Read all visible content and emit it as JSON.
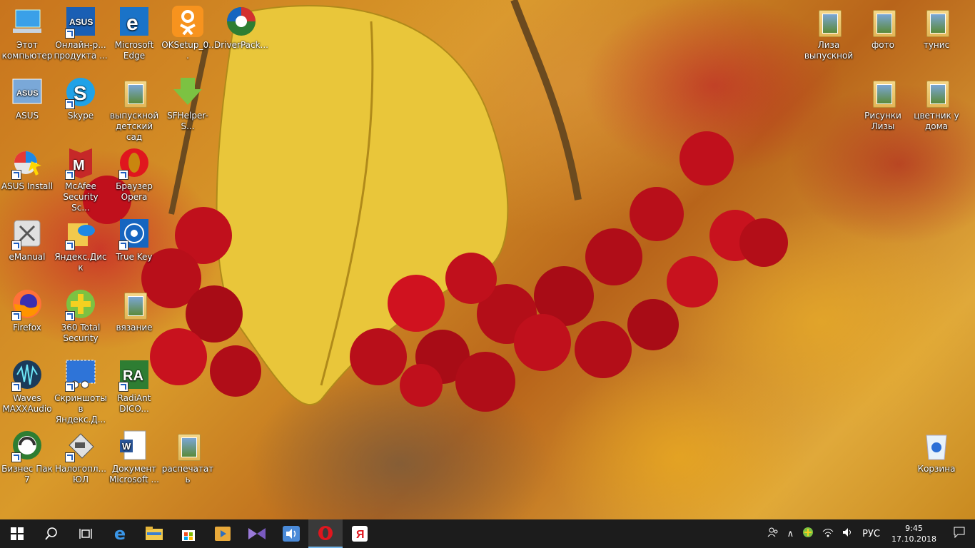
{
  "desktop": {
    "icons_left": [
      {
        "label": "Этот компьютер",
        "icon": "this-pc-icon",
        "shortcut": false
      },
      {
        "label": "Онлайн-р... продукта ...",
        "icon": "asus-online-icon",
        "shortcut": true
      },
      {
        "label": "Microsoft Edge",
        "icon": "edge-icon",
        "shortcut": false
      },
      {
        "label": "OKSetup_0...",
        "icon": "odnoklassniki-icon",
        "shortcut": false
      },
      {
        "label": "DriverPack...",
        "icon": "driverpack-icon",
        "shortcut": false
      },
      {
        "label": "ASUS",
        "icon": "asus-icon",
        "shortcut": false
      },
      {
        "label": "Skype",
        "icon": "skype-icon",
        "shortcut": true
      },
      {
        "label": "выпускной детский сад",
        "icon": "folder-icon",
        "shortcut": false
      },
      {
        "label": "SFHelper-S...",
        "icon": "download-arrow-icon",
        "shortcut": false
      },
      {
        "label": "ASUS Install",
        "icon": "asus-install-icon",
        "shortcut": true
      },
      {
        "label": "McAfee Security Sc...",
        "icon": "mcafee-icon",
        "shortcut": true
      },
      {
        "label": "Браузер Opera",
        "icon": "opera-icon",
        "shortcut": true
      },
      {
        "label": "eManual",
        "icon": "emanual-icon",
        "shortcut": true
      },
      {
        "label": "Яндекс.Диск",
        "icon": "yandex-disk-icon",
        "shortcut": true
      },
      {
        "label": "True Key",
        "icon": "truekey-icon",
        "shortcut": true
      },
      {
        "label": "Firefox",
        "icon": "firefox-icon",
        "shortcut": true
      },
      {
        "label": "360 Total Security",
        "icon": "360-security-icon",
        "shortcut": true
      },
      {
        "label": "вязание",
        "icon": "folder-icon",
        "shortcut": false
      },
      {
        "label": "Waves MAXXAudio",
        "icon": "waves-icon",
        "shortcut": true
      },
      {
        "label": "Скриншоты в Яндекс.Д...",
        "icon": "screenshot-scissors-icon",
        "shortcut": true
      },
      {
        "label": "RadiAnt DICO...",
        "icon": "radiant-icon",
        "shortcut": true
      },
      {
        "label": "Бизнес Пак 7",
        "icon": "business-pack-icon",
        "shortcut": true
      },
      {
        "label": "Налогопл... ЮЛ",
        "icon": "tax-app-icon",
        "shortcut": true
      },
      {
        "label": "Документ Microsoft ...",
        "icon": "word-document-icon",
        "shortcut": false
      },
      {
        "label": "распечатать",
        "icon": "folder-icon",
        "shortcut": false
      }
    ],
    "icons_right": [
      {
        "label": "Лиза выпускной",
        "icon": "folder-icon"
      },
      {
        "label": "фото",
        "icon": "folder-icon"
      },
      {
        "label": "тунис",
        "icon": "folder-icon"
      },
      {
        "label": "Рисунки Лизы",
        "icon": "folder-icon"
      },
      {
        "label": "цветник у дома",
        "icon": "folder-icon"
      },
      {
        "label": "Корзина",
        "icon": "recycle-bin-icon"
      }
    ]
  },
  "taskbar": {
    "buttons": [
      {
        "name": "start-button",
        "icon": "windows-logo-icon"
      },
      {
        "name": "search-button",
        "icon": "search-icon"
      },
      {
        "name": "task-view-button",
        "icon": "task-view-icon"
      },
      {
        "name": "edge-taskbar-button",
        "icon": "edge-icon"
      },
      {
        "name": "explorer-taskbar-button",
        "icon": "folder-icon"
      },
      {
        "name": "store-taskbar-button",
        "icon": "store-icon"
      },
      {
        "name": "media-taskbar-button",
        "icon": "media-player-icon"
      },
      {
        "name": "visual-studio-taskbar-button",
        "icon": "visual-studio-icon"
      },
      {
        "name": "audio-taskbar-button",
        "icon": "speaker-app-icon"
      },
      {
        "name": "opera-taskbar-button",
        "icon": "opera-icon",
        "active": true
      },
      {
        "name": "yandex-taskbar-button",
        "icon": "yandex-browser-icon"
      }
    ],
    "tray": {
      "language": "РУС",
      "time": "9:45",
      "date": "17.10.2018"
    }
  },
  "colors": {
    "taskbar_bg": "#1c1c1c",
    "opera_red": "#e0161e",
    "edge_blue": "#1a73c8",
    "accent": "#76b9ed"
  }
}
